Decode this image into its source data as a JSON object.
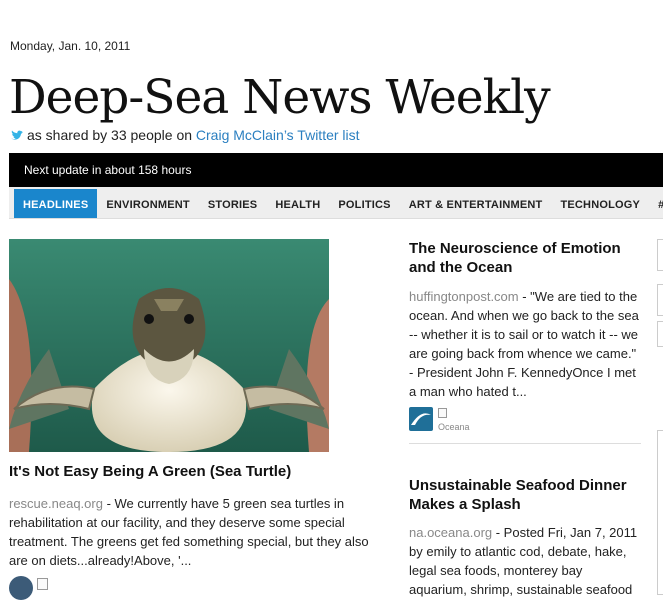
{
  "date": "Monday, Jan. 10, 2011",
  "masthead": "Deep-Sea News Weekly",
  "shared": {
    "prefix": "as shared by 33 people on ",
    "link": "Craig McClain’s Twitter list"
  },
  "update": "Next update in about 158 hours",
  "nav": [
    {
      "label": "HEADLINES",
      "active": true
    },
    {
      "label": "ENVIRONMENT"
    },
    {
      "label": "STORIES"
    },
    {
      "label": "HEALTH"
    },
    {
      "label": "POLITICS"
    },
    {
      "label": "ART & ENTERTAINMENT"
    },
    {
      "label": "TECHNOLOGY"
    },
    {
      "label": "#OC"
    }
  ],
  "lead": {
    "title": "It's Not Easy Being A Green (Sea Turtle)",
    "source": "rescue.neaq.org",
    "text": " - We currently have 5 green sea turtles in rehabilitation at our facility, and they deserve some special treatment. The greens get fed something special, but they also are on diets...already!Above, '..."
  },
  "articles": [
    {
      "title": "The Neuroscience of Emotion and the Ocean",
      "source": "huffingtonpost.com",
      "text": " - \"We are tied to the ocean. And when we go back to the sea -- whether it is to sail or to watch it -- we are going back from whence we came.\"  - President John F. KennedyOnce I met a man who hated t...",
      "attribution": "Oceana"
    },
    {
      "title": "Unsustainable Seafood Dinner Makes a Splash",
      "source": "na.oceana.org",
      "text": " - Posted Fri, Jan 7, 2011 by emily to atlantic cod, debate, hake, legal sea foods, monterey bay aquarium, shrimp, sustainable seafood"
    }
  ],
  "colors": {
    "accent": "#1a86cc",
    "link": "#2a7fc0",
    "bar": "#000000"
  }
}
